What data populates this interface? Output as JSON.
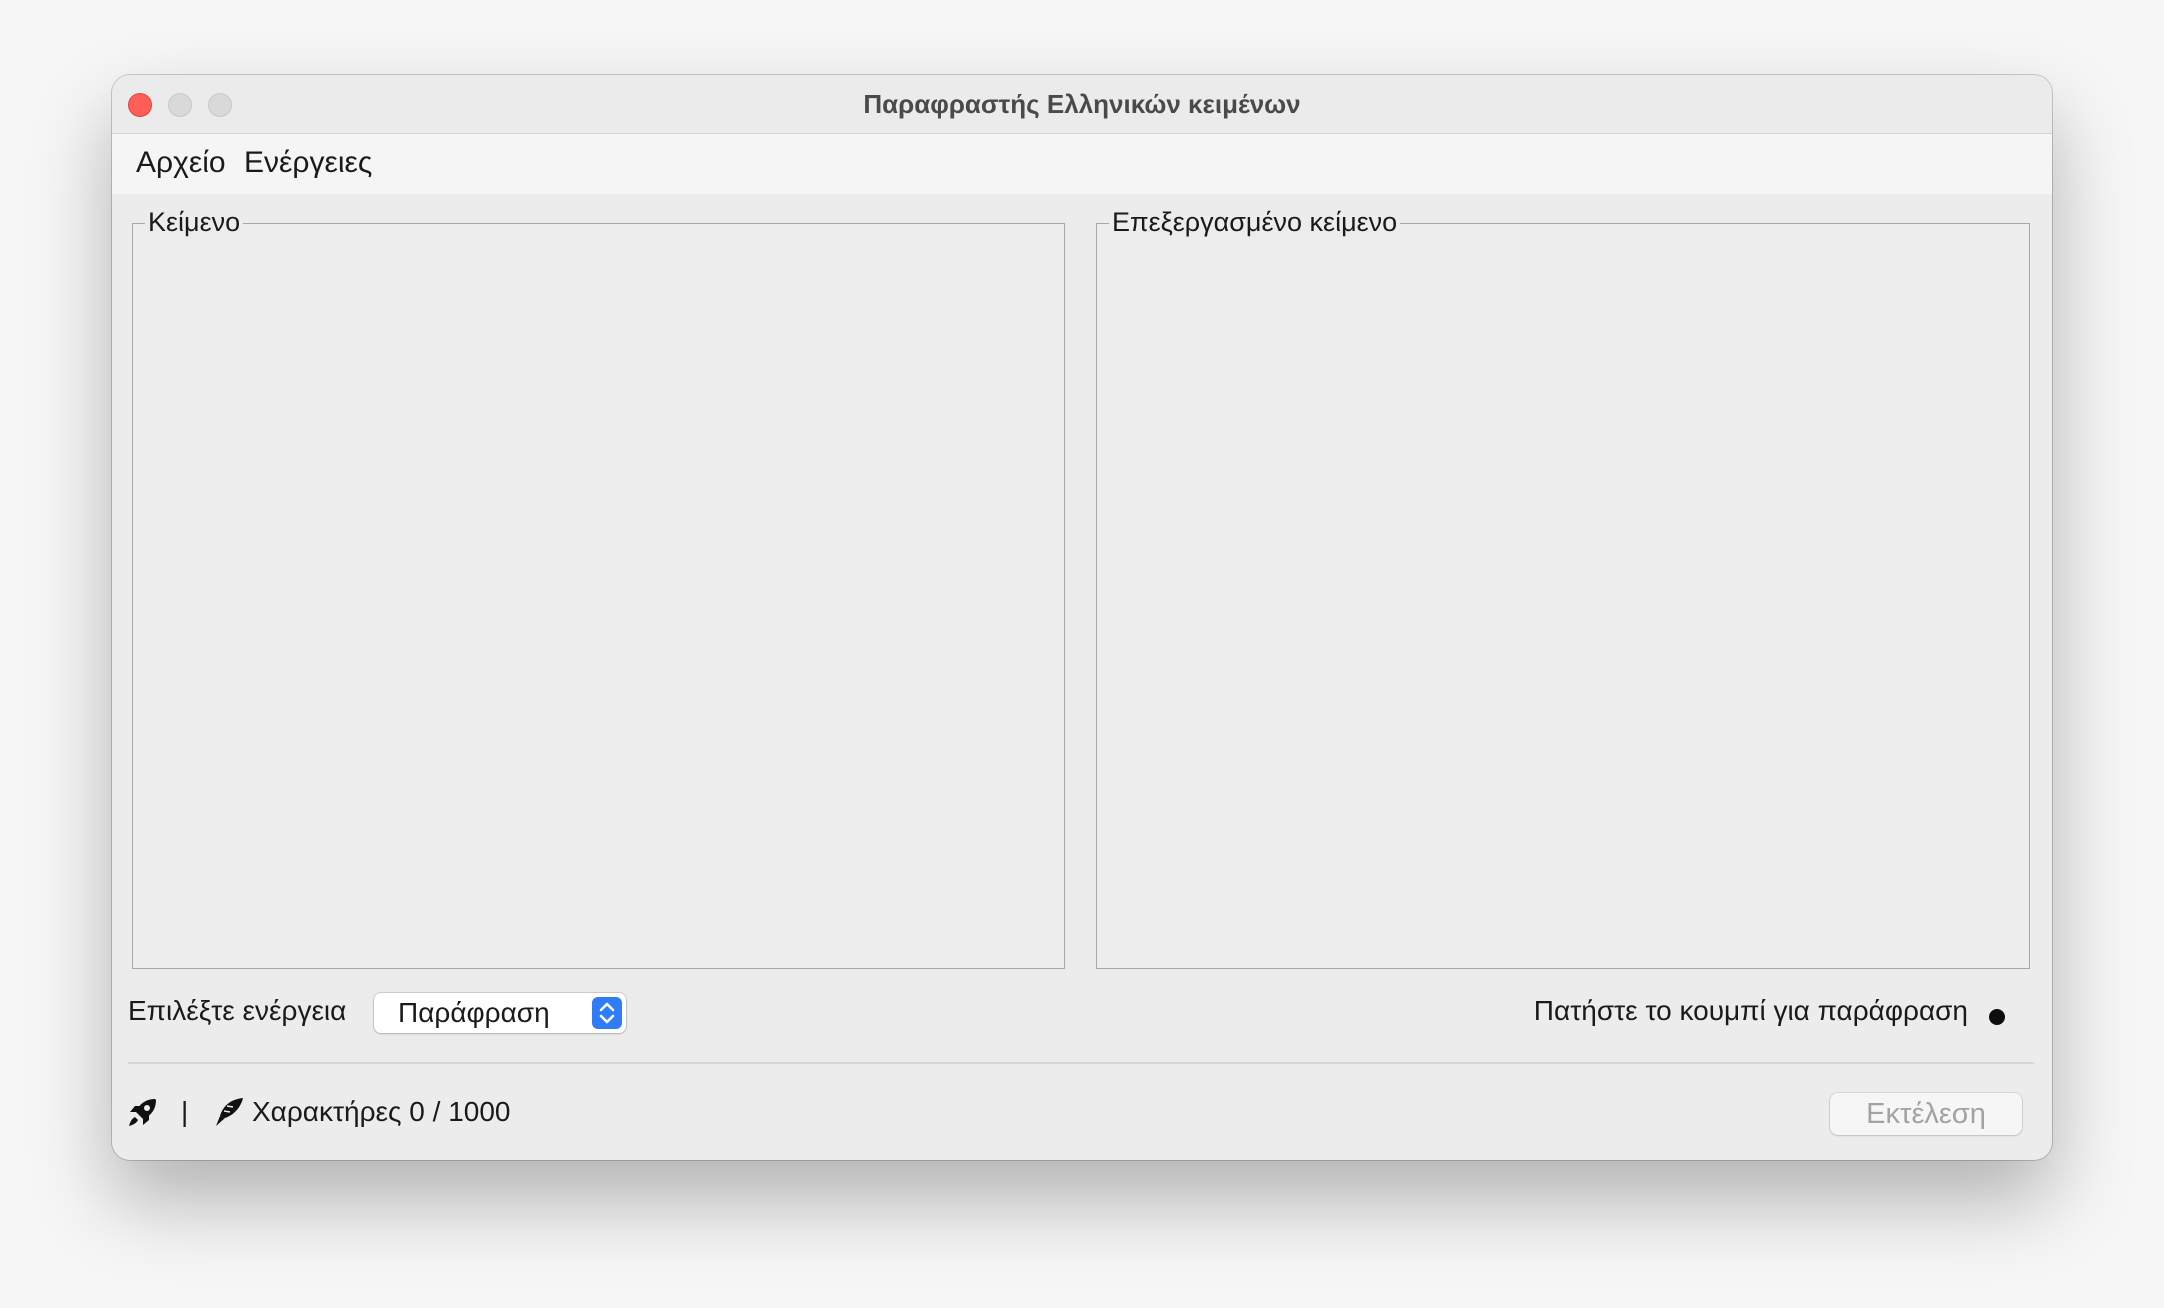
{
  "window": {
    "title": "Παραφραστής Ελληνικών κειμένων"
  },
  "menubar": {
    "items": [
      {
        "label": "Αρχείο"
      },
      {
        "label": "Ενέργειες"
      }
    ]
  },
  "panels": {
    "input": {
      "label": "Κείμενο",
      "text": ""
    },
    "output": {
      "label": "Επεξεργασμένο κείμενο",
      "text": ""
    }
  },
  "actions": {
    "label": "Επιλέξτε ενέργεια",
    "selected": "Παράφραση",
    "hint": "Πατήστε το κουμπί για παράφραση"
  },
  "statusbar": {
    "separator": "|",
    "characters": "Χαρακτήρες 0 / 1000",
    "run_button": "Εκτέλεση",
    "icons": [
      "rocket-icon",
      "quill-icon"
    ]
  }
}
